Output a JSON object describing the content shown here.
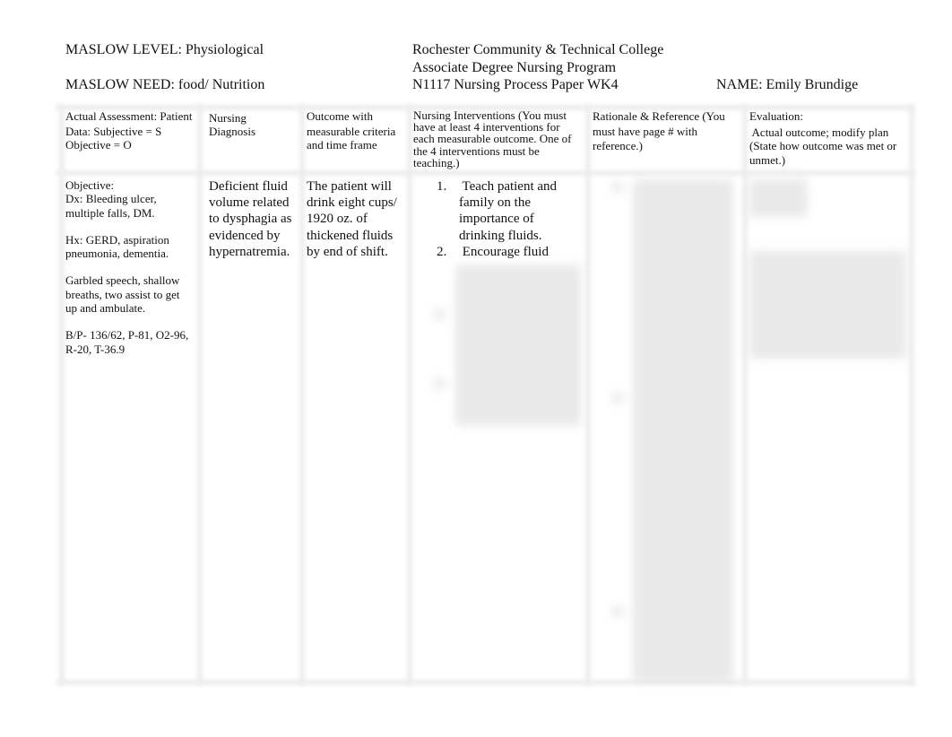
{
  "header": {
    "maslow_level": "MASLOW LEVEL: Physiological",
    "maslow_need": "MASLOW NEED: food/ Nutrition",
    "college": "Rochester Community & Technical College",
    "program": "Associate Degree Nursing Program",
    "course": "N1117 Nursing Process Paper WK4",
    "name": "NAME: Emily Brundige"
  },
  "table": {
    "headers": [
      [
        "Actual Assessment: Patient",
        "Data: Subjective = S",
        "Objective = O"
      ],
      [
        "Nursing",
        "Diagnosis"
      ],
      [
        "Outcome with",
        "measurable criteria",
        "and time frame"
      ],
      [
        "Nursing Interventions (You must",
        "have at least 4 interventions for",
        "each measurable outcome. One of",
        "the 4 interventions must be",
        "teaching.)"
      ],
      [
        "Rationale & Reference (You",
        "must have page # with",
        "reference.)"
      ],
      [
        "Evaluation:",
        " Actual outcome; modify plan",
        "(State how outcome was met or",
        "unmet.)"
      ]
    ],
    "assessment": {
      "label": "Objective:",
      "paragraphs": [
        [
          "Dx: Bleeding ulcer,",
          "multiple falls, DM."
        ],
        [
          "Hx: GERD, aspiration",
          "pneumonia, dementia."
        ],
        [
          "Garbled speech, shallow",
          "breaths, two assist to get",
          "up and ambulate."
        ],
        [
          "B/P- 136/62, P-81, O2-96,",
          "R-20, T-36.9"
        ]
      ]
    },
    "diagnosis": [
      "Deficient fluid",
      "volume related",
      "to dysphagia as",
      "evidenced by",
      "hypernatremia."
    ],
    "outcome": [
      "The patient will",
      "drink eight cups/",
      "1920 oz. of",
      "thickened fluids",
      "by end of shift."
    ],
    "interventions": [
      {
        "num": "1.",
        "lines": [
          " Teach patient and",
          "family on the",
          "importance of",
          "drinking fluids."
        ]
      },
      {
        "num": "2.",
        "lines": [
          " Encourage fluid"
        ]
      }
    ]
  }
}
